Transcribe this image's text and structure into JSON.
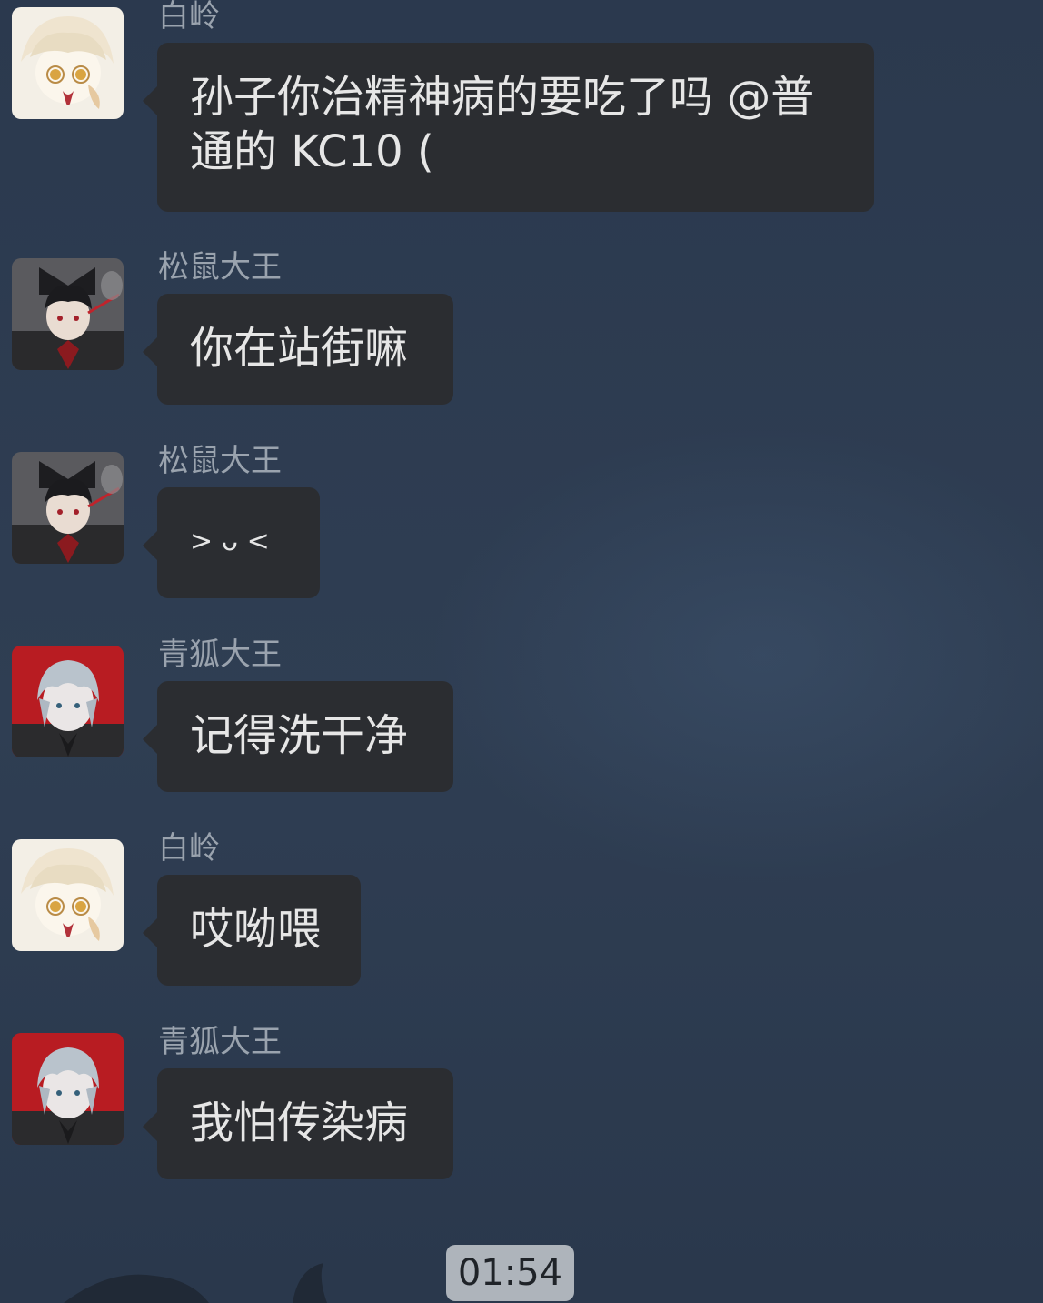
{
  "messages": [
    {
      "sender": "白岭",
      "text": "孙子你治精神病的要吃了吗 @普通的 KC10 (",
      "avatar": "white-haired-avatar"
    },
    {
      "sender": "松鼠大王",
      "text": "你在站街嘛",
      "avatar": "dark-haired-avatar"
    },
    {
      "sender": "松鼠大王",
      "text": "> ᴗ <",
      "avatar": "dark-haired-avatar"
    },
    {
      "sender": "青狐大王",
      "text": "记得洗干净",
      "avatar": "silver-haired-avatar"
    },
    {
      "sender": "白岭",
      "text": "哎呦喂",
      "avatar": "white-haired-avatar"
    },
    {
      "sender": "青狐大王",
      "text": "我怕传染病",
      "avatar": "silver-haired-avatar"
    }
  ],
  "timestamp": "01:54",
  "colors": {
    "background": "#2c3a4f",
    "bubble": "#2b2d31",
    "bubble_text": "#e6e6e6",
    "sender_text": "#9aa3ae",
    "timestamp_pill": "#aeb4bb"
  }
}
